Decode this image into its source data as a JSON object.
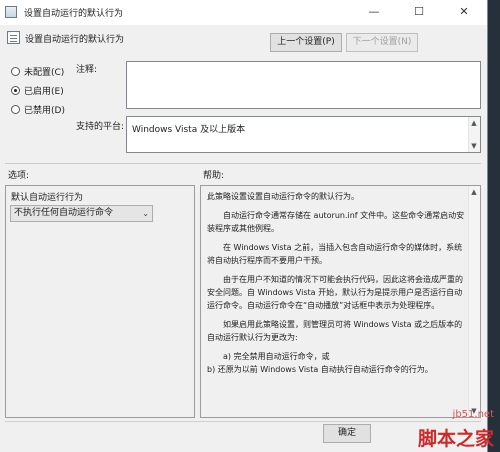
{
  "window": {
    "title": "设置自动运行的默认行为",
    "min_glyph": "—",
    "max_glyph": "☐",
    "close_glyph": "✕"
  },
  "header": {
    "title": "设置自动运行的默认行为",
    "prev_label": "上一个设置(P)",
    "next_label": "下一个设置(N)"
  },
  "state": {
    "options": [
      {
        "label": "未配置(C)",
        "checked": false
      },
      {
        "label": "已启用(E)",
        "checked": true
      },
      {
        "label": "已禁用(D)",
        "checked": false
      }
    ]
  },
  "comment": {
    "label": "注释:",
    "value": ""
  },
  "platform": {
    "label": "支持的平台:",
    "value": "Windows Vista 及以上版本"
  },
  "options_section": {
    "label": "选项:",
    "field_label": "默认自动运行行为",
    "selected": "不执行任何自动运行命令"
  },
  "help_section": {
    "label": "帮助:",
    "paragraphs": [
      "此策略设置设置自动运行命令的默认行为。",
      "自动运行命令通常存储在 autorun.inf 文件中。这些命令通常启动安装程序或其他例程。",
      "在 Windows Vista 之前，当插入包含自动运行命令的媒体时，系统将自动执行程序而不要用户干预。",
      "由于在用户不知道的情况下可能会执行代码，因此这将会造成严重的安全问题。自 Windows Vista 开始，默认行为是提示用户是否运行自动运行命令。自动运行命令在“自动播放”对话框中表示为处理程序。",
      "如果启用此策略设置，则管理员可将 Windows Vista 或之后版本的自动运行默认行为更改为:",
      "a) 完全禁用自动运行命令，或\nb) 还原为以前 Windows Vista 自动执行自动运行命令的行为。"
    ]
  },
  "footer": {
    "ok_label": "确定"
  },
  "watermark": {
    "url": "jb51.net",
    "logo": "脚本之家"
  }
}
